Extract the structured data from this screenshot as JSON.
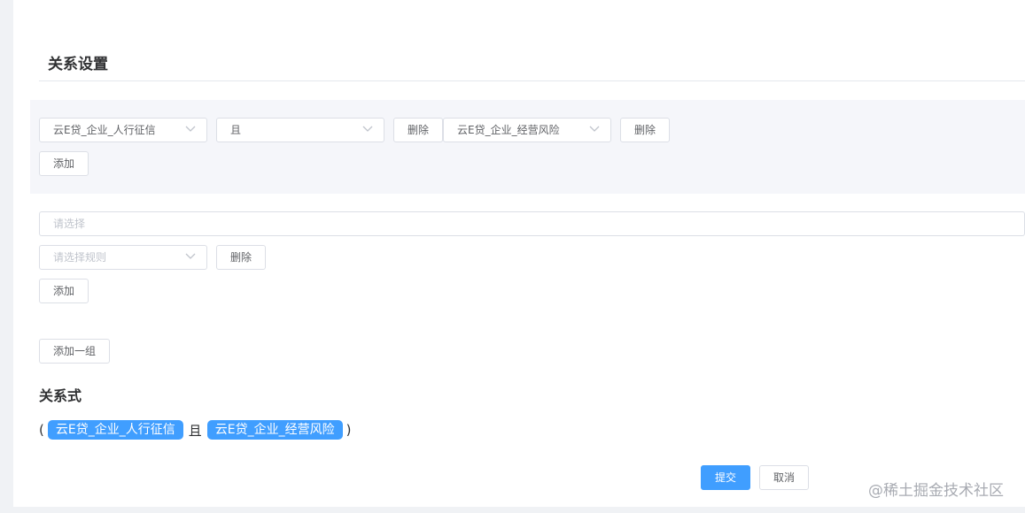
{
  "section_title": "关系设置",
  "group1": {
    "rule1_select": "云E贷_企业_人行征信",
    "logic_select": "且",
    "delete_label_1": "删除",
    "rule2_select": "云E贷_企业_经营风险",
    "delete_label_2": "删除",
    "add_label": "添加"
  },
  "group2": {
    "logic_placeholder": "请选择",
    "rule_placeholder": "请选择规则",
    "delete_label": "删除",
    "add_label": "添加"
  },
  "add_group_label": "添加一组",
  "expression": {
    "title": "关系式",
    "open_paren": "(",
    "tag1": "云E贷_企业_人行征信",
    "and_word": "且",
    "tag2": "云E贷_企业_经营风险",
    "close_paren": ")"
  },
  "footer": {
    "submit_label": "提交",
    "cancel_label": "取消"
  },
  "watermark": "@稀土掘金技术社区",
  "colors": {
    "primary": "#409eff",
    "group_bg": "#f5f6fa",
    "border": "#dcdfe6"
  },
  "icons": [
    "chevron-down-icon"
  ]
}
